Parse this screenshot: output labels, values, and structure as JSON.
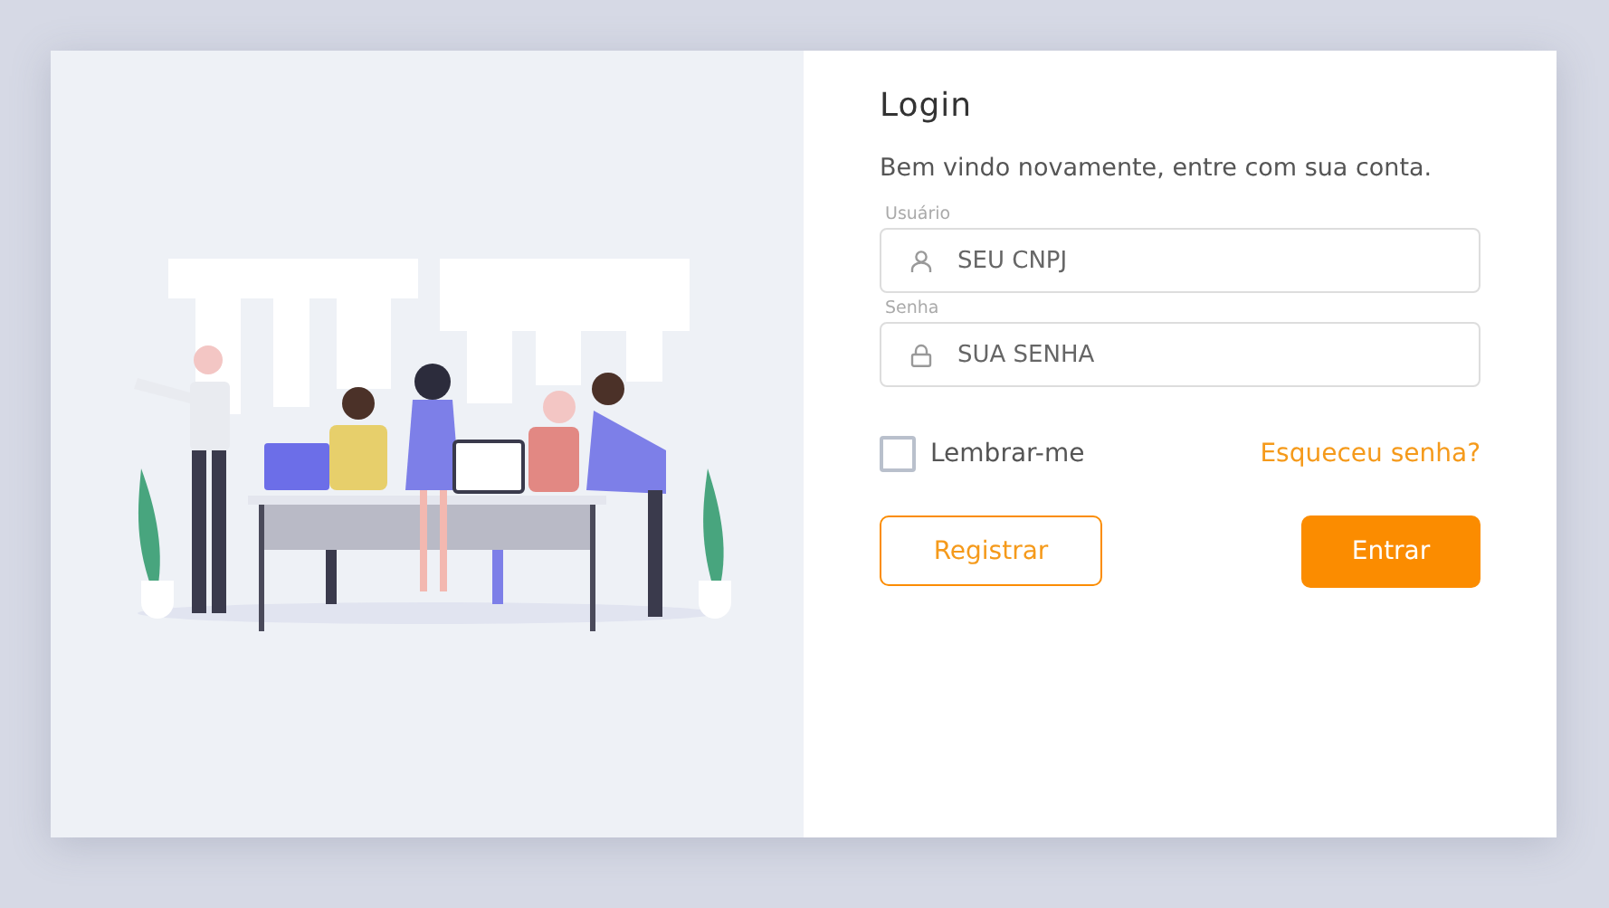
{
  "login": {
    "title": "Login",
    "subtitle": "Bem vindo novamente, entre com sua conta.",
    "fields": [
      {
        "label": "Usuário",
        "placeholder": "SEU CNPJ",
        "kind": "user"
      },
      {
        "label": "Senha",
        "placeholder": "SUA SENHA",
        "kind": "password"
      }
    ],
    "remember": {
      "label": "Lembrar-me",
      "checked": false
    },
    "forgot_link": "Esqueceu senha?",
    "buttons": [
      {
        "label": "Registrar",
        "kind": "outline"
      },
      {
        "label": "Entrar",
        "kind": "primary"
      }
    ]
  }
}
